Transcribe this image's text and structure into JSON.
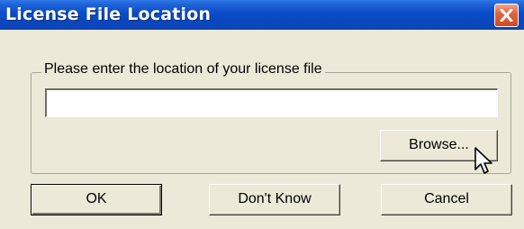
{
  "window": {
    "title": "License File Location"
  },
  "group": {
    "label": "Please enter the location of your license file"
  },
  "license_path": {
    "value": "",
    "placeholder": ""
  },
  "buttons": {
    "browse": "Browse...",
    "ok": "OK",
    "dont_know": "Don't Know",
    "cancel": "Cancel"
  },
  "icons": {
    "close": "close-icon",
    "cursor": "mouse-pointer-icon"
  },
  "colors": {
    "titlebar": "#0a4cc8",
    "close_button": "#e2643d",
    "dialog_background": "#ece9d8"
  }
}
